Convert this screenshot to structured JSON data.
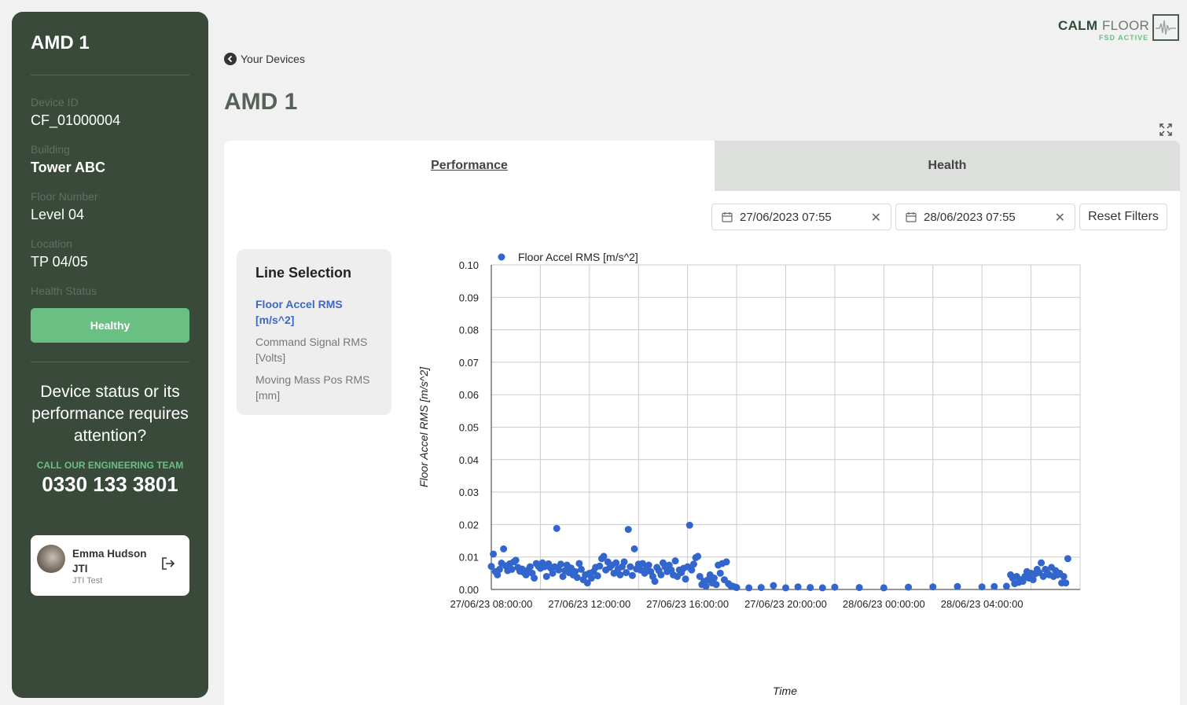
{
  "sidebar": {
    "title": "AMD 1",
    "fields": [
      {
        "label": "Device ID",
        "value": "CF_01000004"
      },
      {
        "label": "Building",
        "value": "Tower ABC"
      },
      {
        "label": "Floor Number",
        "value": "Level 04"
      },
      {
        "label": "Location",
        "value": "TP 04/05"
      }
    ],
    "health_label": "Health Status",
    "health_value": "Healthy",
    "attention_text": "Device status or its performance requires attention?",
    "call_label": "CALL OUR ENGINEERING TEAM",
    "phone": "0330 133 3801",
    "user": {
      "name": "Emma Hudson JTI",
      "org": "JTI Test"
    }
  },
  "logo": {
    "calm": "CALM",
    "floor": "FLOOR",
    "sub": "FSD ACTIVE"
  },
  "header": {
    "back_label": "Your Devices",
    "title": "AMD 1"
  },
  "tabs": [
    {
      "label": "Performance",
      "active": true
    },
    {
      "label": "Health",
      "active": false
    }
  ],
  "filters": {
    "start_date": "27/06/2023 07:55",
    "end_date": "28/06/2023 07:55",
    "reset_label": "Reset Filters"
  },
  "line_selection": {
    "title": "Line Selection",
    "items": [
      {
        "label": "Floor Accel RMS [m/s^2]",
        "active": true
      },
      {
        "label": "Command Signal RMS [Volts]",
        "active": false
      },
      {
        "label": "Moving Mass Pos RMS [mm]",
        "active": false
      }
    ]
  },
  "colors": {
    "sidebar": "#394a3b",
    "accent_green": "#6abf82",
    "series": "#3366cc"
  },
  "chart_data": {
    "type": "scatter",
    "legend": "top-left",
    "grid": true,
    "series": [
      {
        "name": "Floor Accel RMS [m/s^2]",
        "color": "#3366cc"
      }
    ],
    "xlabel": "Time",
    "ylabel": "Floor Accel RMS [m/s^2]",
    "ylim": [
      0,
      0.1
    ],
    "yticks": [
      "0.00",
      "0.01",
      "0.02",
      "0.03",
      "0.04",
      "0.05",
      "0.06",
      "0.07",
      "0.08",
      "0.09",
      "0.10"
    ],
    "xlim": [
      "27/06/23 08:00",
      "28/06/23 08:00"
    ],
    "xticks": [
      "27/06/23 08:00:00",
      "27/06/23 12:00:00",
      "27/06/23 16:00:00",
      "27/06/23 20:00:00",
      "28/06/23 00:00:00",
      "28/06/23 04:00:00"
    ],
    "points": [
      [
        "27/06/23 08:00",
        0.0071
      ],
      [
        "27/06/23 08:05",
        0.0109
      ],
      [
        "27/06/23 08:10",
        0.0055
      ],
      [
        "27/06/23 08:15",
        0.0045
      ],
      [
        "27/06/23 08:20",
        0.0062
      ],
      [
        "27/06/23 08:25",
        0.0081
      ],
      [
        "27/06/23 08:30",
        0.0125
      ],
      [
        "27/06/23 08:35",
        0.0073
      ],
      [
        "27/06/23 08:40",
        0.0058
      ],
      [
        "27/06/23 08:45",
        0.0079
      ],
      [
        "27/06/23 08:50",
        0.0062
      ],
      [
        "27/06/23 08:55",
        0.0085
      ],
      [
        "27/06/23 09:00",
        0.009
      ],
      [
        "27/06/23 09:05",
        0.0068
      ],
      [
        "27/06/23 09:10",
        0.0056
      ],
      [
        "27/06/23 09:15",
        0.0063
      ],
      [
        "27/06/23 09:20",
        0.0052
      ],
      [
        "27/06/23 09:25",
        0.0045
      ],
      [
        "27/06/23 09:30",
        0.006
      ],
      [
        "27/06/23 09:35",
        0.007
      ],
      [
        "27/06/23 09:40",
        0.005
      ],
      [
        "27/06/23 09:45",
        0.0035
      ],
      [
        "27/06/23 09:50",
        0.008
      ],
      [
        "27/06/23 09:55",
        0.0072
      ],
      [
        "27/06/23 10:00",
        0.0065
      ],
      [
        "27/06/23 10:05",
        0.0082
      ],
      [
        "27/06/23 10:10",
        0.007
      ],
      [
        "27/06/23 10:15",
        0.004
      ],
      [
        "27/06/23 10:20",
        0.0079
      ],
      [
        "27/06/23 10:25",
        0.0066
      ],
      [
        "27/06/23 10:30",
        0.005
      ],
      [
        "27/06/23 10:35",
        0.007
      ],
      [
        "27/06/23 10:40",
        0.0188
      ],
      [
        "27/06/23 10:45",
        0.006
      ],
      [
        "27/06/23 10:50",
        0.0078
      ],
      [
        "27/06/23 10:55",
        0.004
      ],
      [
        "27/06/23 11:00",
        0.0058
      ],
      [
        "27/06/23 11:05",
        0.0075
      ],
      [
        "27/06/23 11:10",
        0.0052
      ],
      [
        "27/06/23 11:15",
        0.0066
      ],
      [
        "27/06/23 11:20",
        0.0045
      ],
      [
        "27/06/23 11:25",
        0.0055
      ],
      [
        "27/06/23 11:30",
        0.0037
      ],
      [
        "27/06/23 11:35",
        0.008
      ],
      [
        "27/06/23 11:40",
        0.0062
      ],
      [
        "27/06/23 11:45",
        0.003
      ],
      [
        "27/06/23 11:50",
        0.0045
      ],
      [
        "27/06/23 11:55",
        0.002
      ],
      [
        "27/06/23 12:00",
        0.005
      ],
      [
        "27/06/23 12:05",
        0.0035
      ],
      [
        "27/06/23 12:10",
        0.0055
      ],
      [
        "27/06/23 12:15",
        0.0068
      ],
      [
        "27/06/23 12:20",
        0.0042
      ],
      [
        "27/06/23 12:25",
        0.0072
      ],
      [
        "27/06/23 12:30",
        0.0095
      ],
      [
        "27/06/23 12:35",
        0.0102
      ],
      [
        "27/06/23 12:40",
        0.006
      ],
      [
        "27/06/23 12:45",
        0.0085
      ],
      [
        "27/06/23 12:50",
        0.0068
      ],
      [
        "27/06/23 12:55",
        0.0075
      ],
      [
        "27/06/23 13:00",
        0.005
      ],
      [
        "27/06/23 13:05",
        0.0082
      ],
      [
        "27/06/23 13:10",
        0.0063
      ],
      [
        "27/06/23 13:15",
        0.0045
      ],
      [
        "27/06/23 13:20",
        0.007
      ],
      [
        "27/06/23 13:25",
        0.0085
      ],
      [
        "27/06/23 13:30",
        0.0052
      ],
      [
        "27/06/23 13:35",
        0.0185
      ],
      [
        "27/06/23 13:40",
        0.007
      ],
      [
        "27/06/23 13:45",
        0.0043
      ],
      [
        "27/06/23 13:50",
        0.0125
      ],
      [
        "27/06/23 13:55",
        0.0063
      ],
      [
        "27/06/23 14:00",
        0.0078
      ],
      [
        "27/06/23 14:05",
        0.006
      ],
      [
        "27/06/23 14:10",
        0.008
      ],
      [
        "27/06/23 14:15",
        0.005
      ],
      [
        "27/06/23 14:20",
        0.0065
      ],
      [
        "27/06/23 14:25",
        0.0075
      ],
      [
        "27/06/23 14:30",
        0.0055
      ],
      [
        "27/06/23 14:35",
        0.004
      ],
      [
        "27/06/23 14:40",
        0.0025
      ],
      [
        "27/06/23 14:45",
        0.0068
      ],
      [
        "27/06/23 14:50",
        0.0058
      ],
      [
        "27/06/23 14:55",
        0.0045
      ],
      [
        "27/06/23 15:00",
        0.0082
      ],
      [
        "27/06/23 15:05",
        0.007
      ],
      [
        "27/06/23 15:10",
        0.0055
      ],
      [
        "27/06/23 15:15",
        0.0075
      ],
      [
        "27/06/23 15:20",
        0.006
      ],
      [
        "27/06/23 15:25",
        0.0045
      ],
      [
        "27/06/23 15:30",
        0.0088
      ],
      [
        "27/06/23 15:35",
        0.004
      ],
      [
        "27/06/23 15:40",
        0.006
      ],
      [
        "27/06/23 15:45",
        0.0052
      ],
      [
        "27/06/23 15:50",
        0.0065
      ],
      [
        "27/06/23 15:55",
        0.0032
      ],
      [
        "27/06/23 16:00",
        0.007
      ],
      [
        "27/06/23 16:05",
        0.0198
      ],
      [
        "27/06/23 16:10",
        0.006
      ],
      [
        "27/06/23 16:15",
        0.0078
      ],
      [
        "27/06/23 16:20",
        0.0098
      ],
      [
        "27/06/23 16:25",
        0.0102
      ],
      [
        "27/06/23 16:30",
        0.004
      ],
      [
        "27/06/23 16:35",
        0.0015
      ],
      [
        "27/06/23 16:40",
        0.0025
      ],
      [
        "27/06/23 16:45",
        0.001
      ],
      [
        "27/06/23 16:50",
        0.003
      ],
      [
        "27/06/23 16:55",
        0.0045
      ],
      [
        "27/06/23 17:00",
        0.002
      ],
      [
        "27/06/23 17:05",
        0.0035
      ],
      [
        "27/06/23 17:10",
        0.0015
      ],
      [
        "27/06/23 17:15",
        0.0075
      ],
      [
        "27/06/23 17:20",
        0.005
      ],
      [
        "27/06/23 17:25",
        0.008
      ],
      [
        "27/06/23 17:30",
        0.003
      ],
      [
        "27/06/23 17:35",
        0.0085
      ],
      [
        "27/06/23 17:40",
        0.0018
      ],
      [
        "27/06/23 17:45",
        0.0012
      ],
      [
        "27/06/23 17:50",
        0.001
      ],
      [
        "27/06/23 17:55",
        0.0008
      ],
      [
        "27/06/23 18:00",
        0.0006
      ],
      [
        "27/06/23 18:30",
        0.0005
      ],
      [
        "27/06/23 19:00",
        0.0006
      ],
      [
        "27/06/23 19:30",
        0.0012
      ],
      [
        "27/06/23 20:00",
        0.0005
      ],
      [
        "27/06/23 20:30",
        0.0008
      ],
      [
        "27/06/23 21:00",
        0.0006
      ],
      [
        "27/06/23 21:30",
        0.0005
      ],
      [
        "27/06/23 22:00",
        0.0007
      ],
      [
        "27/06/23 23:00",
        0.0006
      ],
      [
        "28/06/23 00:00",
        0.0005
      ],
      [
        "28/06/23 01:00",
        0.0007
      ],
      [
        "28/06/23 02:00",
        0.0008
      ],
      [
        "28/06/23 03:00",
        0.0009
      ],
      [
        "28/06/23 04:00",
        0.0008
      ],
      [
        "28/06/23 04:30",
        0.0009
      ],
      [
        "28/06/23 05:00",
        0.001
      ],
      [
        "28/06/23 05:10",
        0.0045
      ],
      [
        "28/06/23 05:15",
        0.0035
      ],
      [
        "28/06/23 05:20",
        0.0018
      ],
      [
        "28/06/23 05:25",
        0.004
      ],
      [
        "28/06/23 05:30",
        0.0022
      ],
      [
        "28/06/23 05:35",
        0.003
      ],
      [
        "28/06/23 05:40",
        0.0025
      ],
      [
        "28/06/23 05:45",
        0.004
      ],
      [
        "28/06/23 05:50",
        0.0055
      ],
      [
        "28/06/23 05:55",
        0.0035
      ],
      [
        "28/06/23 06:00",
        0.005
      ],
      [
        "28/06/23 06:05",
        0.003
      ],
      [
        "28/06/23 06:10",
        0.0048
      ],
      [
        "28/06/23 06:15",
        0.0062
      ],
      [
        "28/06/23 06:20",
        0.0052
      ],
      [
        "28/06/23 06:25",
        0.0082
      ],
      [
        "28/06/23 06:30",
        0.004
      ],
      [
        "28/06/23 06:35",
        0.0062
      ],
      [
        "28/06/23 06:40",
        0.005
      ],
      [
        "28/06/23 06:45",
        0.0045
      ],
      [
        "28/06/23 06:50",
        0.0068
      ],
      [
        "28/06/23 06:55",
        0.004
      ],
      [
        "28/06/23 07:00",
        0.0058
      ],
      [
        "28/06/23 07:05",
        0.0045
      ],
      [
        "28/06/23 07:10",
        0.005
      ],
      [
        "28/06/23 07:15",
        0.002
      ],
      [
        "28/06/23 07:20",
        0.004
      ],
      [
        "28/06/23 07:25",
        0.002
      ],
      [
        "28/06/23 07:30",
        0.0095
      ]
    ]
  }
}
